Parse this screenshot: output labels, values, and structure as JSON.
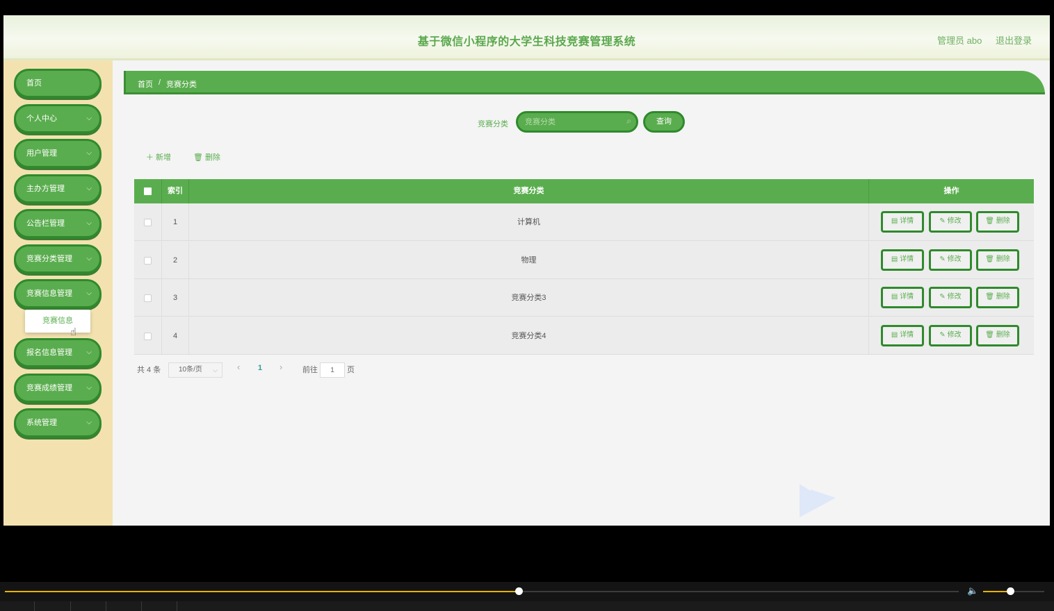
{
  "header": {
    "title": "基于微信小程序的大学生科技竞赛管理系统",
    "admin": "管理员 abo",
    "logout": "退出登录"
  },
  "sidebar": {
    "items": [
      {
        "label": "首页",
        "has_children": false
      },
      {
        "label": "个人中心",
        "has_children": true
      },
      {
        "label": "用户管理",
        "has_children": true
      },
      {
        "label": "主办方管理",
        "has_children": true
      },
      {
        "label": "公告栏管理",
        "has_children": true
      },
      {
        "label": "竞赛分类管理",
        "has_children": true
      },
      {
        "label": "竞赛信息管理",
        "has_children": true
      },
      {
        "label": "报名信息管理",
        "has_children": true
      },
      {
        "label": "竞赛成绩管理",
        "has_children": true
      },
      {
        "label": "系统管理",
        "has_children": true
      }
    ],
    "submenu": {
      "label": "竞赛信息"
    },
    "chevron": "⌵"
  },
  "breadcrumb": {
    "home": "首页",
    "sep": "/",
    "current": "竞赛分类"
  },
  "search": {
    "label": "竞赛分类",
    "placeholder": "竞赛分类",
    "button": "查询",
    "icon": "search-icon"
  },
  "actions": {
    "add": "＋ 新增",
    "delete": "🗑 删除"
  },
  "table": {
    "headers": {
      "index": "索引",
      "category": "竞赛分类",
      "ops": "操作"
    },
    "rows": [
      {
        "index": "1",
        "category": "计算机"
      },
      {
        "index": "2",
        "category": "物理"
      },
      {
        "index": "3",
        "category": "竞赛分类3"
      },
      {
        "index": "4",
        "category": "竞赛分类4"
      }
    ],
    "op_labels": {
      "detail": "▤ 详情",
      "edit": "✎ 修改",
      "delete": "🗑 删除"
    }
  },
  "pagination": {
    "total": "共 4 条",
    "page_size": "10条/页",
    "prev": "‹",
    "current_page": "1",
    "next": "›",
    "goto_prefix": "前往",
    "goto_value": "1",
    "goto_suffix": "页"
  },
  "player": {
    "progress": 0.5386,
    "volume": 0.44,
    "accent": "#e7b400"
  },
  "colors": {
    "primary": "#5aad4e",
    "primary_dark": "#2f8a2c",
    "sidebar_bg": "#f3e2b0"
  }
}
